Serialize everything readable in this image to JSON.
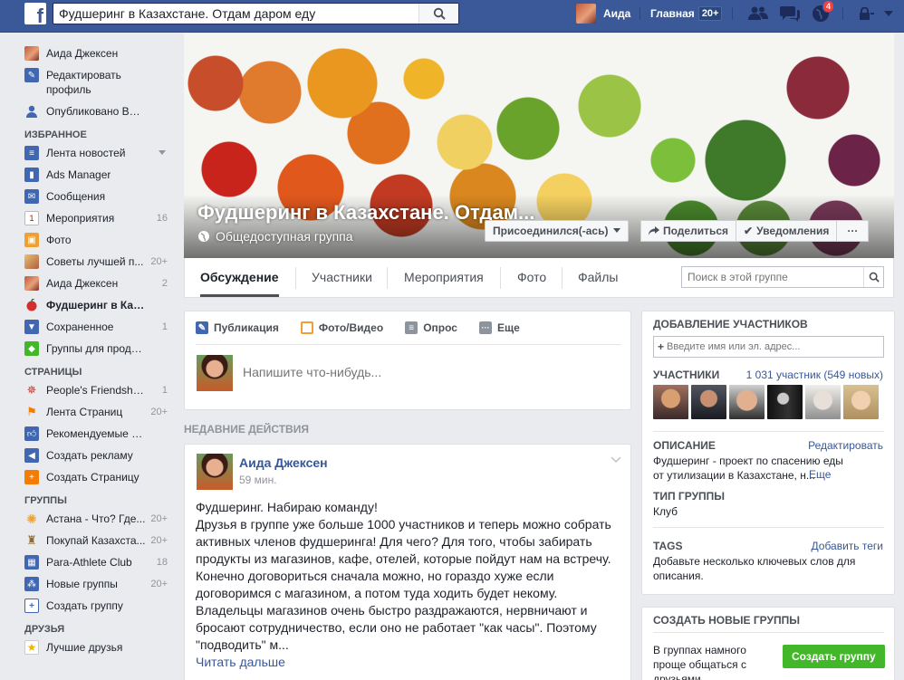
{
  "topbar": {
    "logo": "f",
    "search_value": "Фудшеринг в Казахстане. Отдам даром еду",
    "user_name": "Аида",
    "home_label": "Главная",
    "home_badge": "20+",
    "notif_count": "4",
    "colors": {
      "bar": "#3b5998",
      "badge": "#fa3e3e"
    }
  },
  "sidebar": {
    "profile": [
      {
        "label": "Аида Джексен",
        "icon": "avatar"
      },
      {
        "label": "Редактировать профиль",
        "icon": "pencil-icon"
      },
      {
        "label": "Опубликовано Вами",
        "icon": "user-icon"
      }
    ],
    "favorites_title": "ИЗБРАННОЕ",
    "favorites": [
      {
        "label": "Лента новостей",
        "icon": "newsfeed-icon",
        "count": ""
      },
      {
        "label": "Ads Manager",
        "icon": "ads-icon",
        "count": ""
      },
      {
        "label": "Сообщения",
        "icon": "messages-icon",
        "count": ""
      },
      {
        "label": "Мероприятия",
        "icon": "calendar-icon",
        "count": "16"
      },
      {
        "label": "Фото",
        "icon": "photo-icon",
        "count": ""
      },
      {
        "label": "Советы лучшей п...",
        "icon": "group-avatar",
        "count": "20+"
      },
      {
        "label": "Аида Джексен",
        "icon": "avatar",
        "count": "2"
      },
      {
        "label": "Фудшеринг в Каз...",
        "icon": "apple-icon",
        "count": ""
      },
      {
        "label": "Сохраненное",
        "icon": "bookmark-icon",
        "count": "1"
      },
      {
        "label": "Группы для продажи",
        "icon": "tag-icon",
        "count": ""
      }
    ],
    "pages_title": "СТРАНИЦЫ",
    "pages": [
      {
        "label": "People's Friendship...",
        "icon": "star-badge-icon",
        "count": "1"
      },
      {
        "label": "Лента Страниц",
        "icon": "flag-icon",
        "count": "20+"
      },
      {
        "label": "Рекомендуемые С...",
        "icon": "thumbs-up-icon",
        "count": ""
      },
      {
        "label": "Создать рекламу",
        "icon": "megaphone-icon",
        "count": ""
      },
      {
        "label": "Создать Страницу",
        "icon": "add-page-icon",
        "count": ""
      }
    ],
    "groups_title": "ГРУППЫ",
    "groups": [
      {
        "label": "Астана - Что? Где...",
        "icon": "sun-icon",
        "count": "20+"
      },
      {
        "label": "Покупай Казахста...",
        "icon": "trophy-icon",
        "count": "20+"
      },
      {
        "label": "Para-Athlete Club",
        "icon": "club-icon",
        "count": "18"
      },
      {
        "label": "Новые группы",
        "icon": "groups-icon",
        "count": "20+"
      },
      {
        "label": "Создать группу",
        "icon": "plus-icon",
        "count": ""
      }
    ],
    "friends_title": "ДРУЗЬЯ",
    "friends": [
      {
        "label": "Лучшие друзья",
        "icon": "star-icon",
        "count": ""
      }
    ]
  },
  "cover": {
    "title": "Фудшеринг в Казахстане. Отдам...",
    "privacy": "Общедоступная группа",
    "join_button": "Присоединился(-ась)",
    "share_button": "Поделиться",
    "notify_button": "Уведомления",
    "more_button": "···"
  },
  "tabs": {
    "items": [
      "Обсуждение",
      "Участники",
      "Мероприятия",
      "Фото",
      "Файлы"
    ],
    "search_placeholder": "Поиск в этой группе"
  },
  "composer": {
    "tabs": [
      "Публикация",
      "Фото/Видео",
      "Опрос",
      "Еще"
    ],
    "placeholder": "Напишите что-нибудь..."
  },
  "recent_title": "НЕДАВНИЕ ДЕЙСТВИЯ",
  "post": {
    "author": "Аида Джексен",
    "time": "59 мин.",
    "text": "Фудшеринг. Набираю команду!\nДрузья в группе уже больше 1000 участников и теперь можно собрать\nактивных членов фудшеринга! Для чего? Для того, чтобы забирать\nпродукты из магазинов, кафе, отелей, которые пойдут нам на встречу.\nКонечно договориться сначала можно, но гораздо хуже если\nдоговоримся с магазином, а потом туда ходить будет некому.\nВладельцы магазинов очень быстро раздражаются, нервничают и\nбросают сотрудничество, если оно не работает \"как часы\". Поэтому\n\"подводить\" м...",
    "read_more": "Читать дальше"
  },
  "right": {
    "add_members_title": "ДОБАВЛЕНИЕ УЧАСТНИКОВ",
    "add_members_placeholder": "Введите имя или эл. адрес...",
    "members_title": "УЧАСТНИКИ",
    "members_count": "1 031 участник (549 новых)",
    "description_title": "ОПИСАНИЕ",
    "description_edit": "Редактировать",
    "description_text": "Фудшеринг - проект по спасению еды от утилизации в Казахстане, н...",
    "description_more": "Еще",
    "type_title": "ТИП ГРУППЫ",
    "type_value": "Клуб",
    "tags_title": "TAGS",
    "tags_add": "Добавить теги",
    "tags_text": "Добавьте несколько ключевых слов для описания.",
    "create_title": "СОЗДАТЬ НОВЫЕ ГРУППЫ",
    "create_text": "В группах намного проще общаться с друзьями",
    "create_button": "Создать группу"
  }
}
